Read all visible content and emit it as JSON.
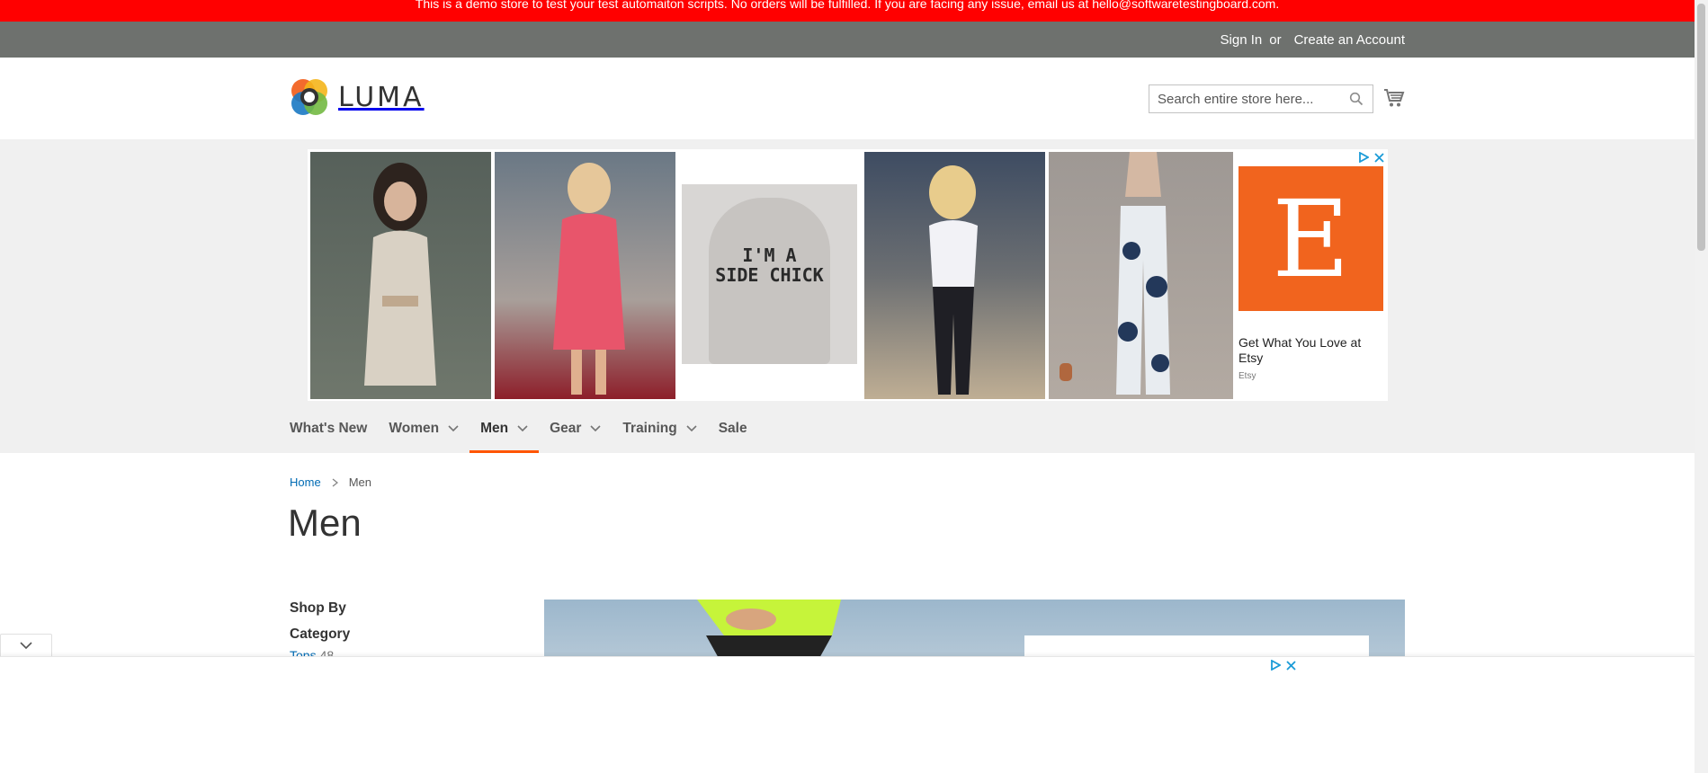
{
  "demo_notice": "This is a demo store to test your test automaiton scripts. No orders will be fulfilled. If you are facing any issue, email us at hello@softwaretestingboard.com.",
  "panel": {
    "sign_in": "Sign In",
    "or": "or",
    "create_account": "Create an Account"
  },
  "header": {
    "logo_text": "LUMA",
    "search_placeholder": "Search entire store here..."
  },
  "ad": {
    "etsy_letter": "E",
    "etsy_title": "Get What You Love at Etsy",
    "etsy_brand": "Etsy",
    "sweatshirt_text_1": "I'M A",
    "sweatshirt_text_2": "SIDE CHICK"
  },
  "nav": {
    "items": [
      {
        "label": "What's New",
        "has_dropdown": false
      },
      {
        "label": "Women",
        "has_dropdown": true
      },
      {
        "label": "Men",
        "has_dropdown": true,
        "active": true
      },
      {
        "label": "Gear",
        "has_dropdown": true
      },
      {
        "label": "Training",
        "has_dropdown": true
      },
      {
        "label": "Sale",
        "has_dropdown": false
      }
    ]
  },
  "breadcrumb": {
    "home": "Home",
    "current": "Men"
  },
  "page_title": "Men",
  "sidebar": {
    "shop_by": "Shop By",
    "category_title": "Category",
    "category_link": "Tops",
    "category_count": "48"
  },
  "colors": {
    "notice_red": "#ff0000",
    "panel_gray": "#6e716e",
    "accent_orange": "#ff5501",
    "link_blue": "#006bb4",
    "etsy_orange": "#f1641e"
  }
}
